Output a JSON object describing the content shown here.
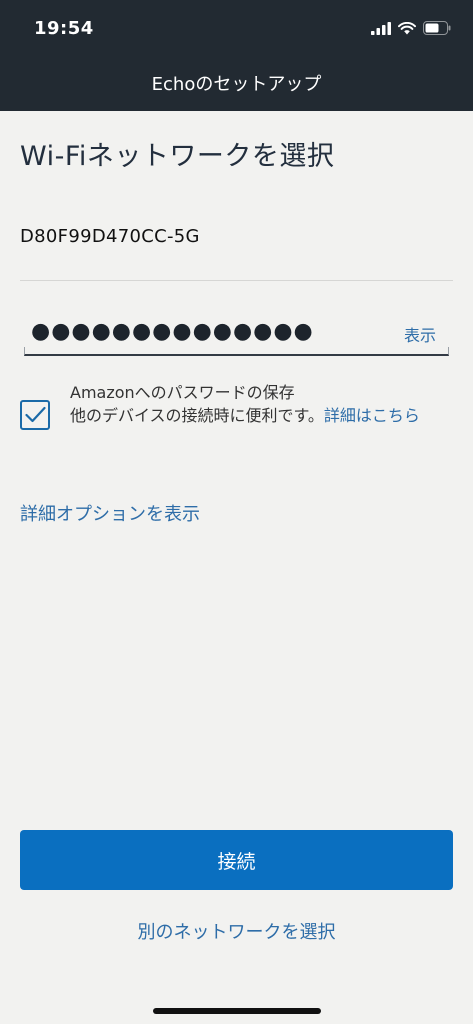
{
  "status_bar": {
    "time": "19:54",
    "icons": [
      "signal-icon",
      "wifi-icon",
      "battery-icon"
    ]
  },
  "nav": {
    "title": "Echoのセットアップ"
  },
  "main": {
    "title": "Wi-Fiネットワークを選択",
    "network_name": "D80F99D470CC-5G",
    "password_mask": "●●●●●●●●●●●●●●",
    "show_label": "表示",
    "save_password": {
      "checked": true,
      "label": "Amazonへのパスワードの保存",
      "description": "他のデバイスの接続時に便利です。",
      "learn_more": "詳細はこちら"
    },
    "advanced_options": "詳細オプションを表示",
    "connect_button": "接続",
    "other_network": "別のネットワークを選択"
  },
  "colors": {
    "header_bg": "#222a32",
    "page_bg": "#f2f2f0",
    "primary": "#0a6fc0",
    "link": "#2e6da8"
  }
}
